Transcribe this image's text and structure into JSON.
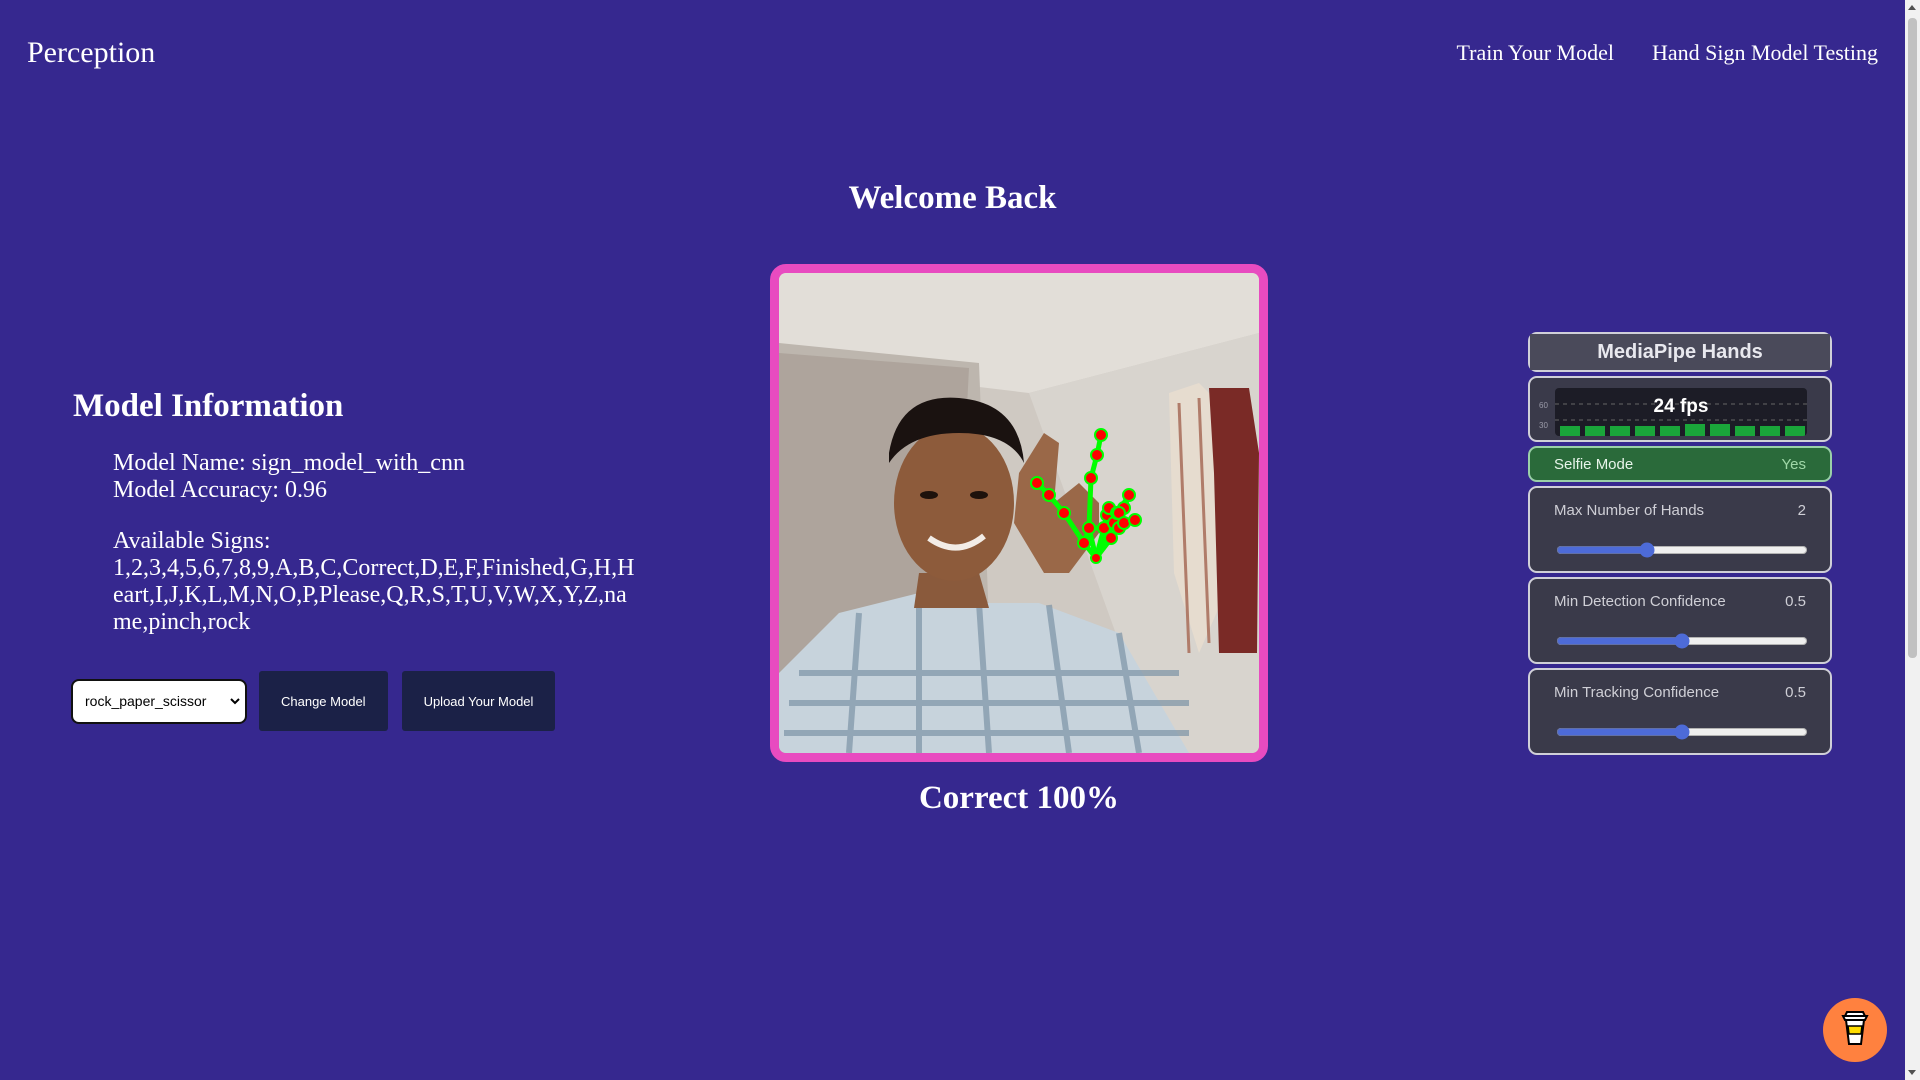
{
  "header": {
    "brand": "Perception",
    "nav": [
      "Train Your Model",
      "Hand Sign Model Testing"
    ]
  },
  "welcome": "Welcome Back",
  "model_info": {
    "title": "Model Information",
    "name_line": "Model Name: sign_model_with_cnn",
    "accuracy_line": "Model Accuracy: 0.96",
    "signs_label": "Available Signs:",
    "signs": "1,2,3,4,5,6,7,8,9,A,B,C,Correct,D,E,F,Finished,G,H,Heart,I,J,K,L,M,N,O,P,Please,Q,R,S,T,U,V,W,X,Y,Z,name,pinch,rock"
  },
  "controls": {
    "model_select_value": "rock_paper_scissor",
    "change_label": "Change Model",
    "upload_label": "Upload Your Model"
  },
  "result": "Correct 100%",
  "mediapipe": {
    "title": "MediaPipe Hands",
    "fps": "24 fps",
    "fps_scale_high": "60",
    "fps_scale_low": "30",
    "selfie_label": "Selfie Mode",
    "selfie_value": "Yes",
    "sliders": [
      {
        "label": "Max Number of Hands",
        "value": "2",
        "fraction": 0.35
      },
      {
        "label": "Min Detection Confidence",
        "value": "0.5",
        "fraction": 0.5
      },
      {
        "label": "Min Tracking Confidence",
        "value": "0.5",
        "fraction": 0.5
      }
    ]
  },
  "colors": {
    "background": "#36288f",
    "frame": "#e84bc0",
    "button": "#1b2147",
    "landmark": "#ff0000",
    "connector": "#00ff00"
  },
  "icons": [
    "coffee-cup-icon"
  ]
}
